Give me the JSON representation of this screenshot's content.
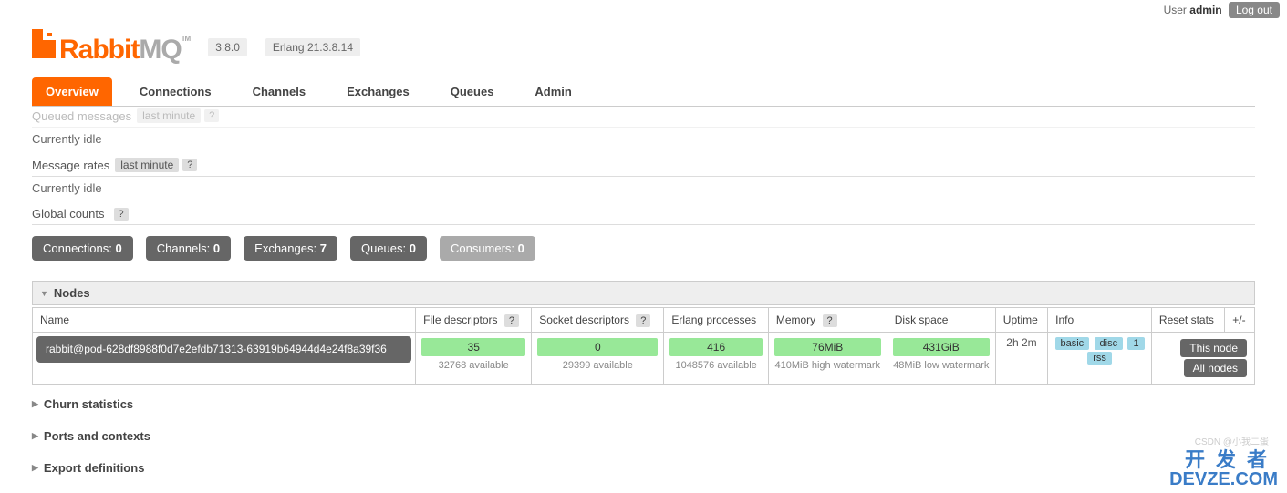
{
  "topbar": {
    "user_label": "User",
    "user_name": "admin",
    "logout": "Log out"
  },
  "logo": {
    "rabbit": "Rabbit",
    "mq": "MQ",
    "tm": "TM"
  },
  "versions": {
    "rabbitmq": "3.8.0",
    "erlang": "Erlang 21.3.8.14"
  },
  "tabs": [
    "Overview",
    "Connections",
    "Channels",
    "Exchanges",
    "Queues",
    "Admin"
  ],
  "sections": {
    "queued_label": "Queued messages",
    "queued_time": "last minute",
    "queued_idle": "Currently idle",
    "rates_label": "Message rates",
    "rates_time": "last minute",
    "rates_idle": "Currently idle",
    "global_label": "Global counts"
  },
  "counts": [
    {
      "label": "Connections:",
      "value": "0",
      "disabled": false
    },
    {
      "label": "Channels:",
      "value": "0",
      "disabled": false
    },
    {
      "label": "Exchanges:",
      "value": "7",
      "disabled": false
    },
    {
      "label": "Queues:",
      "value": "0",
      "disabled": false
    },
    {
      "label": "Consumers:",
      "value": "0",
      "disabled": true
    }
  ],
  "nodes": {
    "title": "Nodes",
    "plusminus": "+/-",
    "headers": {
      "name": "Name",
      "fd": "File descriptors",
      "sd": "Socket descriptors",
      "ep": "Erlang processes",
      "mem": "Memory",
      "disk": "Disk space",
      "uptime": "Uptime",
      "info": "Info",
      "reset": "Reset stats"
    },
    "row": {
      "name": "rabbit@pod-628df8988f0d7e2efdb71313-63919b64944d4e24f8a39f36",
      "fd": {
        "val": "35",
        "sub": "32768 available"
      },
      "sd": {
        "val": "0",
        "sub": "29399 available"
      },
      "ep": {
        "val": "416",
        "sub": "1048576 available"
      },
      "mem": {
        "val": "76MiB",
        "sub": "410MiB high watermark"
      },
      "disk": {
        "val": "431GiB",
        "sub": "48MiB low watermark"
      },
      "uptime": "2h 2m",
      "info": [
        "basic",
        "disc",
        "1",
        "rss"
      ],
      "reset": [
        "This node",
        "All nodes"
      ]
    }
  },
  "panels": {
    "churn": "Churn statistics",
    "ports": "Ports and contexts",
    "export": "Export definitions"
  },
  "watermark": {
    "cn": "开发者",
    "en": "DEVZE.COM",
    "csdn": "CSDN @小我二蛋"
  }
}
